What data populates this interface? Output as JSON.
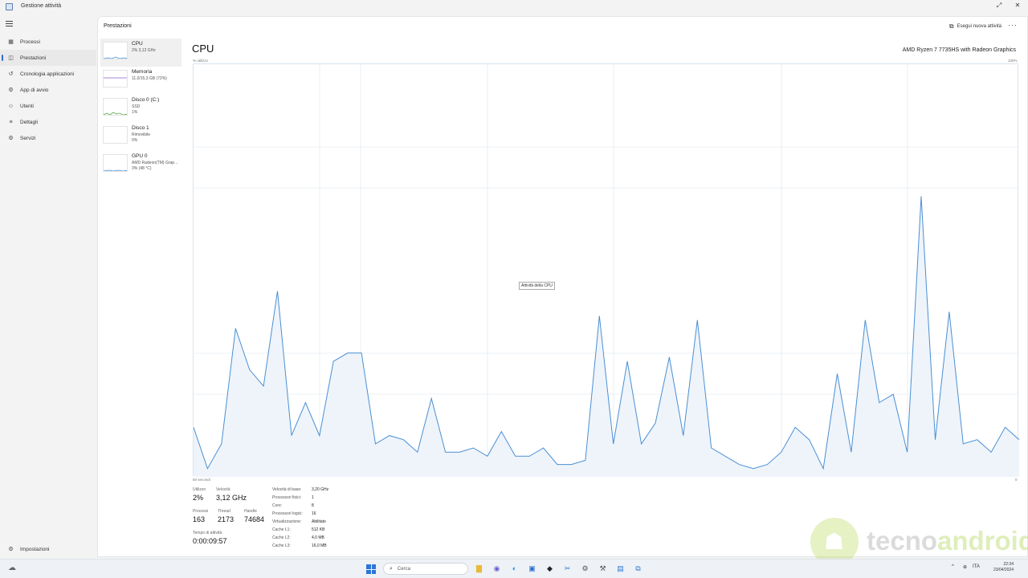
{
  "window": {
    "title": "Gestione attività",
    "icons": {
      "app": "task-manager-icon",
      "minimize": "minimize-icon",
      "close": "close-icon"
    }
  },
  "nav": {
    "items": [
      {
        "label": "Processi",
        "icon": "processes-icon",
        "glyph": "▦",
        "active": false
      },
      {
        "label": "Prestazioni",
        "icon": "performance-icon",
        "glyph": "◫",
        "active": true
      },
      {
        "label": "Cronologia applicazioni",
        "icon": "history-icon",
        "glyph": "↺",
        "active": false
      },
      {
        "label": "App di avvio",
        "icon": "startup-icon",
        "glyph": "⚙",
        "active": false
      },
      {
        "label": "Utenti",
        "icon": "users-icon",
        "glyph": "☺",
        "active": false
      },
      {
        "label": "Dettagli",
        "icon": "details-icon",
        "glyph": "≡",
        "active": false
      },
      {
        "label": "Servizi",
        "icon": "services-icon",
        "glyph": "⚙",
        "active": false
      }
    ],
    "settings_label": "Impostazioni"
  },
  "header": {
    "section_title": "Prestazioni",
    "run_task_label": "Esegui nuova attività",
    "more_label": "···"
  },
  "perf_list": [
    {
      "name": "CPU",
      "sub1": "2% 3,12 GHz",
      "sub2": "",
      "active": true,
      "color": "#4a8fd4"
    },
    {
      "name": "Memoria",
      "sub1": "11,0/15,3 GB (72%)",
      "sub2": "",
      "active": false,
      "color": "#8a5fc0"
    },
    {
      "name": "Disco 0 (C:)",
      "sub1": "SSD",
      "sub2": "1%",
      "active": false,
      "color": "#5ca84a"
    },
    {
      "name": "Disco 1",
      "sub1": "Rimovibile",
      "sub2": "0%",
      "active": false,
      "color": "#5ca84a"
    },
    {
      "name": "GPU 0",
      "sub1": "AMD Radeon(TM) Grap...",
      "sub2": "3% (48 °C)",
      "active": false,
      "color": "#4a8fd4"
    }
  ],
  "cpu": {
    "title": "CPU",
    "model": "AMD Ryzen 7 7735HS with Radeon Graphics",
    "graph_label_top": "% utilizzo",
    "graph_max": "100%",
    "graph_time": "60 secondi",
    "graph_zero": "0",
    "tooltip": "Attività della CPU",
    "utilization_history": [
      12,
      2,
      8,
      36,
      26,
      22,
      45,
      10,
      18,
      10,
      28,
      30,
      30,
      8,
      10,
      9,
      6,
      19,
      6,
      6,
      7,
      5,
      11,
      5,
      5,
      7,
      3,
      3,
      4,
      39,
      8,
      28,
      8,
      13,
      29,
      10,
      38,
      7,
      5,
      3,
      2,
      3,
      6,
      12,
      9,
      2,
      25,
      6,
      38,
      18,
      20,
      6,
      68,
      9,
      40,
      8,
      9,
      6,
      12,
      9
    ]
  },
  "stats": {
    "utilization": {
      "label": "Utilizzo",
      "value": "2%"
    },
    "speed": {
      "label": "Velocità",
      "value": "3,12 GHz"
    },
    "processes": {
      "label": "Processi",
      "value": "163"
    },
    "threads": {
      "label": "Thread",
      "value": "2173"
    },
    "handles": {
      "label": "Handle",
      "value": "74684"
    },
    "uptime": {
      "label": "Tempo di attività",
      "value": "0:00:09:57"
    },
    "details": [
      {
        "label": "Velocità di base:",
        "value": "3,20 GHz"
      },
      {
        "label": "Processori fisici:",
        "value": "1"
      },
      {
        "label": "Core:",
        "value": "8"
      },
      {
        "label": "Processori logici:",
        "value": "16"
      },
      {
        "label": "Virtualizzazione:",
        "value": "Abilitato"
      },
      {
        "label": "Cache L1:",
        "value": "512 KB"
      },
      {
        "label": "Cache L2:",
        "value": "4,0 MB"
      },
      {
        "label": "Cache L3:",
        "value": "16,0 MB"
      }
    ]
  },
  "watermark": {
    "part1": "tecno",
    "part2": "android",
    "icon": "android-robot-icon"
  },
  "taskbar": {
    "search_placeholder": "Cerca",
    "apps": [
      "file-explorer-icon",
      "chat-icon",
      "edge-icon",
      "store-icon",
      "app-icon",
      "snipping-icon",
      "settings-icon",
      "tools-icon",
      "task-manager-icon",
      "remote-icon"
    ],
    "tray_lang": "ITA",
    "time": "22:34",
    "date": "23/04/2024"
  }
}
